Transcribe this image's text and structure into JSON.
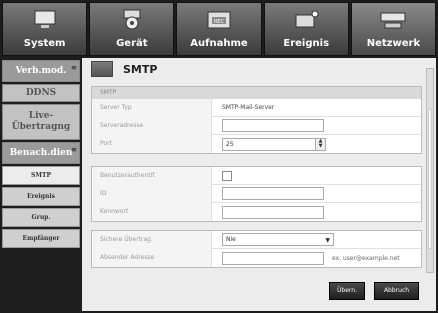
{
  "topnav": [
    {
      "label": "System",
      "icon": "monitor-icon"
    },
    {
      "label": "Gerät",
      "icon": "camera-icon"
    },
    {
      "label": "Aufnahme",
      "icon": "rec-icon"
    },
    {
      "label": "Ereignis",
      "icon": "alarm-icon"
    },
    {
      "label": "Netzwerk",
      "icon": "network-icon"
    }
  ],
  "sidebar": {
    "main": [
      {
        "label": "Verb.mod."
      },
      {
        "label": "DDNS"
      },
      {
        "label": "Live-\nÜbertragng"
      },
      {
        "label": "Benach.dien"
      }
    ],
    "sub": [
      {
        "label": "SMTP"
      },
      {
        "label": "Ereignis"
      },
      {
        "label": "Grup."
      },
      {
        "label": "Empfänger"
      }
    ]
  },
  "page": {
    "title": "SMTP"
  },
  "section1": {
    "header": "SMTP",
    "server_type_label": "Server Typ",
    "server_type_value": "SMTP-Mail-Server",
    "server_address_label": "Serveradresse",
    "server_address_value": "",
    "port_label": "Port",
    "port_value": "25"
  },
  "section2": {
    "auth_label": "Benutzerauthentif.",
    "id_label": "ID",
    "id_value": "",
    "password_label": "Kennwort",
    "password_value": ""
  },
  "section3": {
    "secure_label": "Sichere Übertrag.",
    "secure_value": "Nie",
    "sender_label": "Absender Adresse",
    "sender_value": "",
    "sender_hint": "ex. user@example.net"
  },
  "buttons": {
    "apply": "Übern.",
    "cancel": "Abbruch"
  }
}
